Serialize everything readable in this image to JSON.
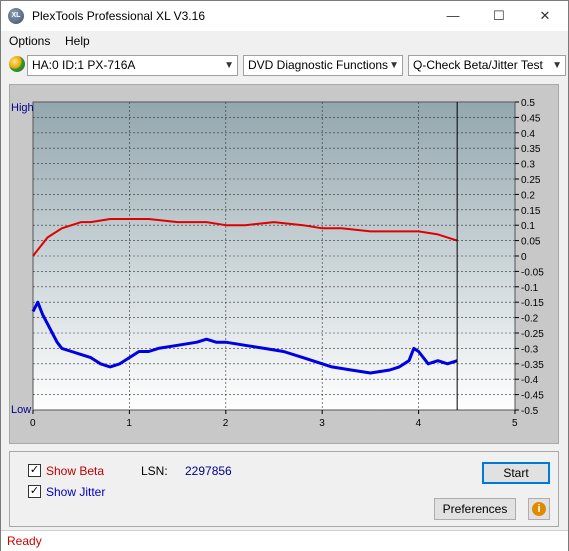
{
  "window": {
    "title": "PlexTools Professional XL V3.16",
    "app_icon_text": "XL",
    "minimize": "—",
    "maximize": "☐",
    "close": "✕"
  },
  "menu": [
    {
      "label": "Options"
    },
    {
      "label": "Help"
    }
  ],
  "toolbar": {
    "drive": "HA:0 ID:1  PX-716A",
    "function": "DVD Diagnostic Functions",
    "test": "Q-Check Beta/Jitter Test"
  },
  "chart_data": {
    "type": "line",
    "left_axis_labels": {
      "top": "High",
      "bottom": "Low"
    },
    "x_ticks": [
      "0",
      "1",
      "2",
      "3",
      "4",
      "5"
    ],
    "xlim": [
      0,
      5
    ],
    "y_ticks": [
      "0.5",
      "0.45",
      "0.4",
      "0.35",
      "0.3",
      "0.25",
      "0.2",
      "0.15",
      "0.1",
      "0.05",
      "0",
      "-0.05",
      "-0.1",
      "-0.15",
      "-0.2",
      "-0.25",
      "-0.3",
      "-0.35",
      "-0.4",
      "-0.45",
      "-0.5"
    ],
    "ylim": [
      -0.5,
      0.5
    ],
    "end_marker_x": 4.4,
    "grid": true,
    "series": [
      {
        "color": "#e00000",
        "x": [
          0,
          0.05,
          0.1,
          0.15,
          0.2,
          0.3,
          0.4,
          0.5,
          0.6,
          0.8,
          1.0,
          1.2,
          1.5,
          1.8,
          2.0,
          2.2,
          2.5,
          2.8,
          3.0,
          3.2,
          3.5,
          3.8,
          4.0,
          4.2,
          4.4
        ],
        "values": [
          0.0,
          0.02,
          0.04,
          0.06,
          0.07,
          0.09,
          0.1,
          0.11,
          0.11,
          0.12,
          0.12,
          0.12,
          0.11,
          0.11,
          0.1,
          0.1,
          0.11,
          0.1,
          0.09,
          0.09,
          0.08,
          0.08,
          0.08,
          0.07,
          0.05
        ]
      },
      {
        "color": "#0000e0",
        "x": [
          0,
          0.05,
          0.1,
          0.15,
          0.2,
          0.25,
          0.3,
          0.4,
          0.5,
          0.6,
          0.7,
          0.8,
          0.9,
          1.0,
          1.1,
          1.2,
          1.3,
          1.5,
          1.7,
          1.8,
          1.9,
          2.0,
          2.2,
          2.4,
          2.6,
          2.8,
          3.0,
          3.1,
          3.3,
          3.5,
          3.7,
          3.8,
          3.9,
          3.95,
          4.0,
          4.1,
          4.2,
          4.3,
          4.4
        ],
        "values": [
          -0.18,
          -0.15,
          -0.19,
          -0.22,
          -0.25,
          -0.28,
          -0.3,
          -0.31,
          -0.32,
          -0.33,
          -0.35,
          -0.36,
          -0.35,
          -0.33,
          -0.31,
          -0.31,
          -0.3,
          -0.29,
          -0.28,
          -0.27,
          -0.28,
          -0.28,
          -0.29,
          -0.3,
          -0.31,
          -0.33,
          -0.35,
          -0.36,
          -0.37,
          -0.38,
          -0.37,
          -0.36,
          -0.34,
          -0.3,
          -0.31,
          -0.35,
          -0.34,
          -0.35,
          -0.34
        ]
      }
    ]
  },
  "options": {
    "show_beta": "Show Beta",
    "show_jitter": "Show Jitter",
    "lsn_label": "LSN:",
    "lsn_value": "2297856"
  },
  "buttons": {
    "start": "Start",
    "preferences": "Preferences",
    "info": "i"
  },
  "status": "Ready"
}
